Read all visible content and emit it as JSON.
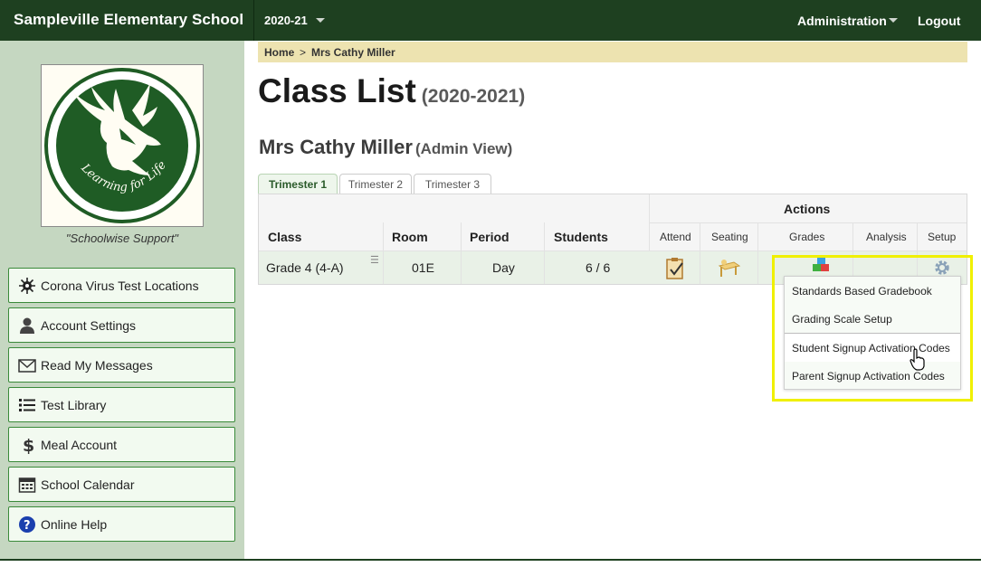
{
  "header": {
    "school_name": "Sampleville Elementary School",
    "school_year": "2020-21",
    "admin_menu": "Administration",
    "logout": "Logout"
  },
  "sidebar": {
    "logo_text": "Learning for Life",
    "caption": "\"Schoolwise Support\"",
    "items": [
      {
        "label": "Corona Virus Test Locations",
        "icon": "virus-icon"
      },
      {
        "label": "Account Settings",
        "icon": "user-icon"
      },
      {
        "label": "Read My Messages",
        "icon": "envelope-icon"
      },
      {
        "label": "Test Library",
        "icon": "list-icon"
      },
      {
        "label": "Meal Account",
        "icon": "dollar-icon"
      },
      {
        "label": "School Calendar",
        "icon": "calendar-icon"
      },
      {
        "label": "Online Help",
        "icon": "help-icon"
      }
    ]
  },
  "breadcrumb": {
    "home": "Home",
    "separator": ">",
    "current": "Mrs Cathy Miller"
  },
  "page": {
    "title": "Class List",
    "title_year": "(2020-2021)",
    "teacher": "Mrs Cathy Miller",
    "view": "(Admin View)"
  },
  "tabs": [
    "Trimester 1",
    "Trimester 2",
    "Trimester 3"
  ],
  "table": {
    "actions_header": "Actions",
    "columns": [
      "Class",
      "Room",
      "Period",
      "Students"
    ],
    "action_columns": [
      "Attend",
      "Seating",
      "Grades",
      "Analysis",
      "Setup"
    ],
    "row": {
      "class": "Grade 4 (4-A)",
      "room": "01E",
      "period": "Day",
      "students": "6 / 6"
    }
  },
  "setup_menu": {
    "items": [
      "Standards Based Gradebook",
      "Grading Scale Setup",
      "Student Signup Activation Codes",
      "Parent Signup Activation Codes"
    ]
  },
  "colors": {
    "topbar": "#1e4020",
    "sidebar": "#c5d7c1",
    "highlight": "#f0f000",
    "breadcrumb": "#ede3b0"
  }
}
